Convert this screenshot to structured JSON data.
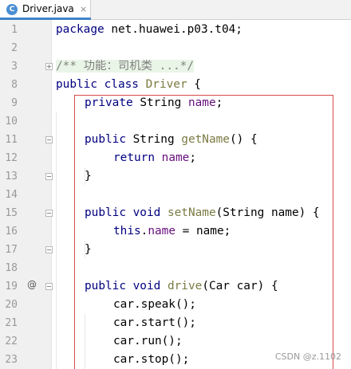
{
  "tab": {
    "icon_letter": "C",
    "label": "Driver.java",
    "close": "×"
  },
  "gutter": {
    "override_marker": "@"
  },
  "lines": [
    {
      "num": "1"
    },
    {
      "num": "2"
    },
    {
      "num": "3"
    },
    {
      "num": "8"
    },
    {
      "num": "9"
    },
    {
      "num": "10"
    },
    {
      "num": "11"
    },
    {
      "num": "12"
    },
    {
      "num": "13"
    },
    {
      "num": "14"
    },
    {
      "num": "15"
    },
    {
      "num": "16"
    },
    {
      "num": "17"
    },
    {
      "num": "18"
    },
    {
      "num": "19"
    },
    {
      "num": "20"
    },
    {
      "num": "21"
    },
    {
      "num": "22"
    },
    {
      "num": "23"
    }
  ],
  "code": {
    "l1_kw": "package",
    "l1_rest": " net.huawei.p03.t04;",
    "l3_comment": "/** 功能：司机类 ...*/",
    "l8_kw": "public class",
    "l8_name": " Driver",
    "l8_rest": " {",
    "l9_kw": "private",
    "l9_type": " String ",
    "l9_field": "name",
    "l9_rest": ";",
    "l11_kw": "public",
    "l11_type": " String ",
    "l11_method": "getName",
    "l11_rest": "() {",
    "l12_kw": "return",
    "l12_sp": " ",
    "l12_field": "name",
    "l12_rest": ";",
    "l13": "}",
    "l15_kw": "public void",
    "l15_sp": " ",
    "l15_method": "setName",
    "l15_rest": "(String name) {",
    "l16_kw": "this",
    "l16_dot": ".",
    "l16_field": "name",
    "l16_rest": " = name;",
    "l17": "}",
    "l19_kw": "public void",
    "l19_sp": " ",
    "l19_method": "drive",
    "l19_rest": "(Car car) {",
    "l20": "car.speak();",
    "l21": "car.start();",
    "l22": "car.run();",
    "l23": "car.stop();"
  },
  "watermark": "CSDN @z.1102",
  "colors": {
    "keyword": "#000080",
    "field": "#660e7a",
    "method": "#7a7a43",
    "comment": "#808080",
    "highlight_box": "#d64a4a",
    "tab_accent": "#4083c9"
  }
}
